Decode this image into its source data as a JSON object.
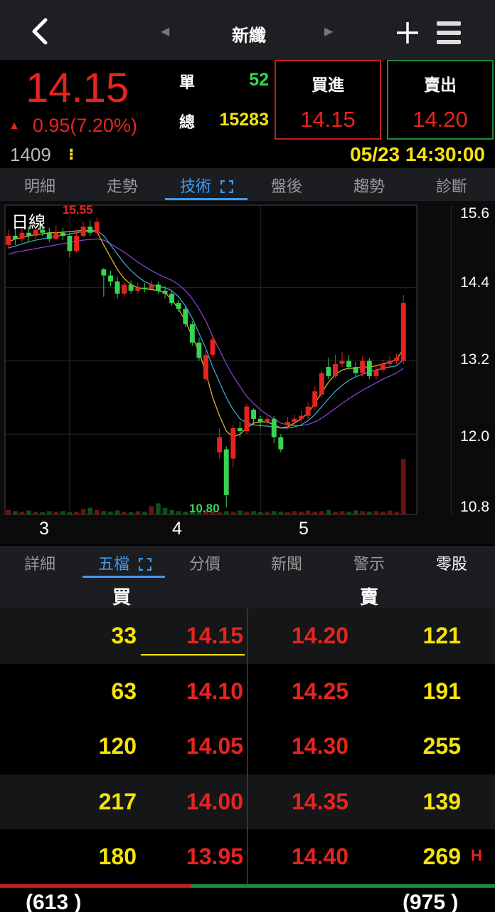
{
  "header": {
    "title": "新纖",
    "prev_symbol": "◀",
    "next_symbol": "▶"
  },
  "quote": {
    "price": "14.15",
    "change_arrow": "▲",
    "change": "0.95(7.20%)",
    "single_label": "單",
    "single_volume": "52",
    "total_label": "總",
    "total_volume": "15283",
    "buy_label": "買進",
    "buy_price": "14.15",
    "sell_label": "賣出",
    "sell_price": "14.20",
    "code": "1409",
    "code_menu": "⁝",
    "datetime": "05/23 14:30:00"
  },
  "tabs_top": [
    "明細",
    "走勢",
    "技術",
    "盤後",
    "趨勢",
    "診斷"
  ],
  "active_top_tab": "技術",
  "tabs_bottom": [
    "詳細",
    "五檔",
    "分價",
    "新聞",
    "警示",
    "零股"
  ],
  "active_bottom_tab": "五檔",
  "orderbook": {
    "bid_header": "買",
    "ask_header": "賣",
    "rows": [
      {
        "bid_vol": "33",
        "bid_px": "14.15",
        "ask_px": "14.20",
        "ask_vol": "121"
      },
      {
        "bid_vol": "63",
        "bid_px": "14.10",
        "ask_px": "14.25",
        "ask_vol": "191"
      },
      {
        "bid_vol": "120",
        "bid_px": "14.05",
        "ask_px": "14.30",
        "ask_vol": "255"
      },
      {
        "bid_vol": "217",
        "bid_px": "14.00",
        "ask_px": "14.35",
        "ask_vol": "139"
      },
      {
        "bid_vol": "180",
        "bid_px": "13.95",
        "ask_px": "14.40",
        "ask_vol": "269"
      }
    ],
    "h_mark": "H",
    "total_bid": "(613 )",
    "total_ask": "(975 )",
    "bid_share": 0.386
  },
  "colors": {
    "up": "#e52420",
    "down": "#39d353",
    "volume": "#f5e30a",
    "accent": "#3d9bf2"
  },
  "chart_data": {
    "type": "candlestick",
    "title": "日線",
    "y_ticks": [
      "15.6",
      "14.4",
      "13.2",
      "12.0",
      "10.8"
    ],
    "ylim": [
      10.8,
      15.6
    ],
    "x_ticks": [
      {
        "label": "3",
        "index": 9
      },
      {
        "label": "4",
        "index": 37
      },
      {
        "label": "5",
        "index": 65
      }
    ],
    "high_label": "15.55",
    "low_label": "10.80",
    "candles": [
      [
        15.1,
        15.25,
        15.35,
        15.05
      ],
      [
        15.25,
        15.2,
        15.35,
        15.1
      ],
      [
        15.2,
        15.3,
        15.4,
        15.15
      ],
      [
        15.3,
        15.25,
        15.4,
        15.15
      ],
      [
        15.25,
        15.35,
        15.45,
        15.2
      ],
      [
        15.35,
        15.3,
        15.42,
        15.25
      ],
      [
        15.3,
        15.2,
        15.38,
        15.15
      ],
      [
        15.2,
        15.3,
        15.42,
        15.18
      ],
      [
        15.3,
        15.25,
        15.38,
        15.18
      ],
      [
        15.25,
        15.0,
        15.3,
        14.9
      ],
      [
        15.0,
        15.25,
        15.35,
        14.98
      ],
      [
        15.25,
        15.4,
        15.48,
        15.22
      ],
      [
        15.4,
        15.3,
        15.5,
        15.25
      ],
      [
        15.3,
        15.48,
        15.55,
        15.28
      ],
      [
        14.7,
        14.6,
        14.72,
        14.25
      ],
      [
        14.6,
        14.5,
        14.68,
        14.42
      ],
      [
        14.5,
        14.3,
        14.58,
        14.22
      ],
      [
        14.3,
        14.45,
        14.5,
        14.25
      ],
      [
        14.45,
        14.35,
        14.52,
        14.3
      ],
      [
        14.35,
        14.4,
        14.48,
        14.3
      ],
      [
        14.4,
        14.38,
        14.48,
        14.32
      ],
      [
        14.38,
        14.45,
        14.52,
        14.35
      ],
      [
        14.45,
        14.35,
        14.5,
        14.3
      ],
      [
        14.35,
        14.3,
        14.42,
        14.22
      ],
      [
        14.3,
        14.15,
        14.35,
        14.1
      ],
      [
        14.15,
        14.05,
        14.2,
        14.0
      ],
      [
        14.05,
        13.8,
        14.1,
        13.75
      ],
      [
        13.8,
        13.5,
        13.85,
        13.45
      ],
      [
        13.5,
        13.25,
        13.58,
        13.2
      ],
      [
        12.9,
        13.3,
        13.4,
        12.85
      ],
      [
        13.3,
        13.55,
        13.62,
        13.25
      ],
      [
        11.7,
        11.95,
        12.1,
        11.6
      ],
      [
        11.75,
        11.0,
        11.8,
        10.8
      ],
      [
        11.6,
        12.1,
        12.15,
        11.45
      ],
      [
        12.1,
        12.05,
        12.2,
        11.95
      ],
      [
        12.05,
        12.45,
        12.5,
        12.0
      ],
      [
        12.4,
        12.25,
        12.42,
        12.15
      ],
      [
        12.25,
        12.2,
        12.3,
        12.1
      ],
      [
        12.2,
        12.25,
        12.32,
        12.12
      ],
      [
        12.25,
        11.95,
        12.3,
        11.85
      ],
      [
        11.95,
        11.75,
        12.0,
        11.7
      ],
      [
        12.15,
        12.2,
        12.28,
        12.08
      ],
      [
        12.2,
        12.25,
        12.32,
        12.15
      ],
      [
        12.25,
        12.3,
        12.38,
        12.18
      ],
      [
        12.3,
        12.45,
        12.52,
        12.25
      ],
      [
        12.45,
        12.7,
        12.78,
        12.4
      ],
      [
        12.65,
        13.0,
        13.05,
        12.6
      ],
      [
        13.1,
        12.95,
        13.25,
        12.9
      ],
      [
        12.95,
        13.15,
        13.3,
        12.92
      ],
      [
        13.15,
        13.2,
        13.35,
        13.1
      ],
      [
        13.2,
        13.1,
        13.3,
        13.05
      ],
      [
        13.1,
        13.0,
        13.18,
        12.95
      ],
      [
        13.0,
        13.2,
        13.28,
        12.95
      ],
      [
        13.2,
        12.95,
        13.25,
        12.9
      ],
      [
        12.95,
        13.05,
        13.15,
        12.9
      ],
      [
        13.05,
        13.15,
        13.22,
        13.0
      ],
      [
        13.15,
        13.2,
        13.28,
        13.1
      ],
      [
        13.2,
        13.25,
        13.32,
        13.15
      ],
      [
        13.2,
        14.15,
        14.28,
        13.15
      ]
    ],
    "volumes": [
      0.08,
      0.06,
      0.05,
      0.07,
      0.05,
      0.04,
      0.06,
      0.05,
      0.06,
      0.04,
      0.05,
      0.1,
      0.12,
      0.08,
      0.06,
      0.05,
      0.07,
      0.05,
      0.04,
      0.06,
      0.05,
      0.15,
      0.2,
      0.12,
      0.08,
      0.06,
      0.05,
      0.07,
      0.05,
      0.06,
      0.05,
      0.04,
      0.06,
      0.05,
      0.07,
      0.05,
      0.06,
      0.04,
      0.05,
      0.06,
      0.05,
      0.04,
      0.06,
      0.05,
      0.07,
      0.05,
      0.06,
      0.08,
      0.05,
      0.06,
      0.05,
      0.07,
      0.06,
      0.05,
      0.06,
      0.05,
      0.07,
      0.05,
      1.0
    ],
    "ma_short": [
      15.15,
      15.2,
      15.22,
      15.25,
      15.27,
      15.28,
      15.3,
      15.3,
      15.31,
      15.32,
      15.33,
      15.34,
      15.33,
      15.32,
      15.1,
      14.9,
      14.7,
      14.55,
      14.45,
      14.4,
      14.38,
      14.37,
      14.35,
      14.32,
      14.2,
      14.05,
      13.85,
      13.6,
      13.35,
      13.0,
      12.6,
      12.3,
      12.05,
      11.95,
      12.0,
      12.1,
      12.18,
      12.2,
      12.2,
      12.15,
      12.1,
      12.12,
      12.18,
      12.25,
      12.35,
      12.5,
      12.68,
      12.85,
      12.98,
      13.05,
      13.08,
      13.08,
      13.1,
      13.1,
      13.12,
      13.15,
      13.18,
      13.22,
      13.4
    ],
    "ma_mid": [
      15.05,
      15.08,
      15.12,
      15.15,
      15.18,
      15.2,
      15.22,
      15.24,
      15.26,
      15.28,
      15.3,
      15.32,
      15.33,
      15.34,
      15.25,
      15.1,
      14.95,
      14.8,
      14.68,
      14.58,
      14.5,
      14.45,
      14.42,
      14.4,
      14.35,
      14.25,
      14.1,
      13.9,
      13.65,
      13.4,
      13.1,
      12.85,
      12.6,
      12.4,
      12.25,
      12.18,
      12.15,
      12.14,
      12.13,
      12.12,
      12.1,
      12.1,
      12.12,
      12.15,
      12.22,
      12.32,
      12.45,
      12.58,
      12.7,
      12.8,
      12.88,
      12.94,
      12.98,
      13.02,
      13.05,
      13.08,
      13.1,
      13.12,
      13.22
    ],
    "ma_long": [
      14.95,
      14.98,
      15.0,
      15.02,
      15.04,
      15.06,
      15.08,
      15.1,
      15.12,
      15.14,
      15.16,
      15.18,
      15.19,
      15.2,
      15.18,
      15.12,
      15.05,
      14.98,
      14.9,
      14.82,
      14.75,
      14.68,
      14.62,
      14.57,
      14.52,
      14.45,
      14.35,
      14.22,
      14.05,
      13.85,
      13.6,
      13.38,
      13.15,
      12.95,
      12.78,
      12.62,
      12.5,
      12.4,
      12.32,
      12.25,
      12.18,
      12.15,
      12.14,
      12.14,
      12.16,
      12.2,
      12.26,
      12.34,
      12.42,
      12.5,
      12.58,
      12.65,
      12.72,
      12.78,
      12.84,
      12.9,
      12.95,
      13.0,
      13.08
    ]
  }
}
